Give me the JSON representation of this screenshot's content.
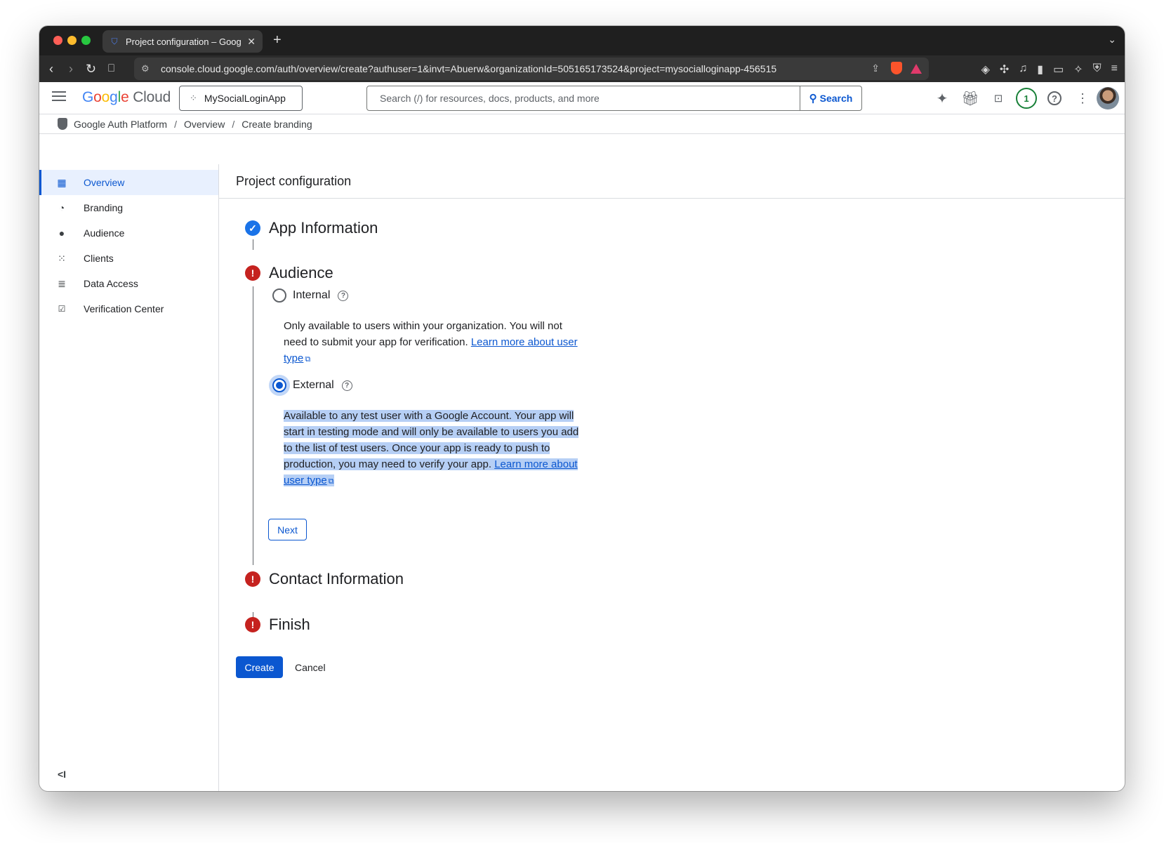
{
  "browser": {
    "tab_title": "Project configuration – Googl",
    "url": "console.cloud.google.com/auth/overview/create?authuser=1&invt=Abuerw&organizationId=505165173524&project=mysocialloginapp-456515"
  },
  "header": {
    "logo_google": [
      "G",
      "o",
      "o",
      "g",
      "l",
      "e"
    ],
    "logo_cloud": "Cloud",
    "project_name": "MySocialLoginApp",
    "search_placeholder": "Search (/) for resources, docs, products, and more",
    "search_button": "Search",
    "notification_count": "1"
  },
  "breadcrumb": {
    "items": [
      "Google Auth Platform",
      "Overview",
      "Create branding"
    ],
    "separator": "/"
  },
  "sidebar": {
    "items": [
      {
        "label": "Overview",
        "icon": "dashboard-icon",
        "active": true
      },
      {
        "label": "Branding",
        "icon": "palette-icon"
      },
      {
        "label": "Audience",
        "icon": "person-icon"
      },
      {
        "label": "Clients",
        "icon": "grid-icon"
      },
      {
        "label": "Data Access",
        "icon": "data-access-icon"
      },
      {
        "label": "Verification Center",
        "icon": "verification-icon"
      }
    ],
    "collapse_glyph": "<I"
  },
  "main": {
    "title": "Project configuration",
    "steps": {
      "app_info": "App Information",
      "audience": "Audience",
      "contact": "Contact Information",
      "finish": "Finish"
    },
    "internal": {
      "label": "Internal",
      "desc": "Only available to users within your organization. You will not need to submit your app for verification.",
      "link": "Learn more about user type"
    },
    "external": {
      "label": "External",
      "desc": "Available to any test user with a Google Account. Your app will start in testing mode and will only be available to users you add to the list of test users. Once your app is ready to push to production, you may need to verify your app.",
      "link": "Learn more about user type"
    },
    "next_button": "Next",
    "create_button": "Create",
    "cancel_button": "Cancel"
  },
  "colors": {
    "accent": "#0b57d0",
    "error": "#c5221f",
    "done": "#1a73e8",
    "selection": "#b6cff5"
  }
}
